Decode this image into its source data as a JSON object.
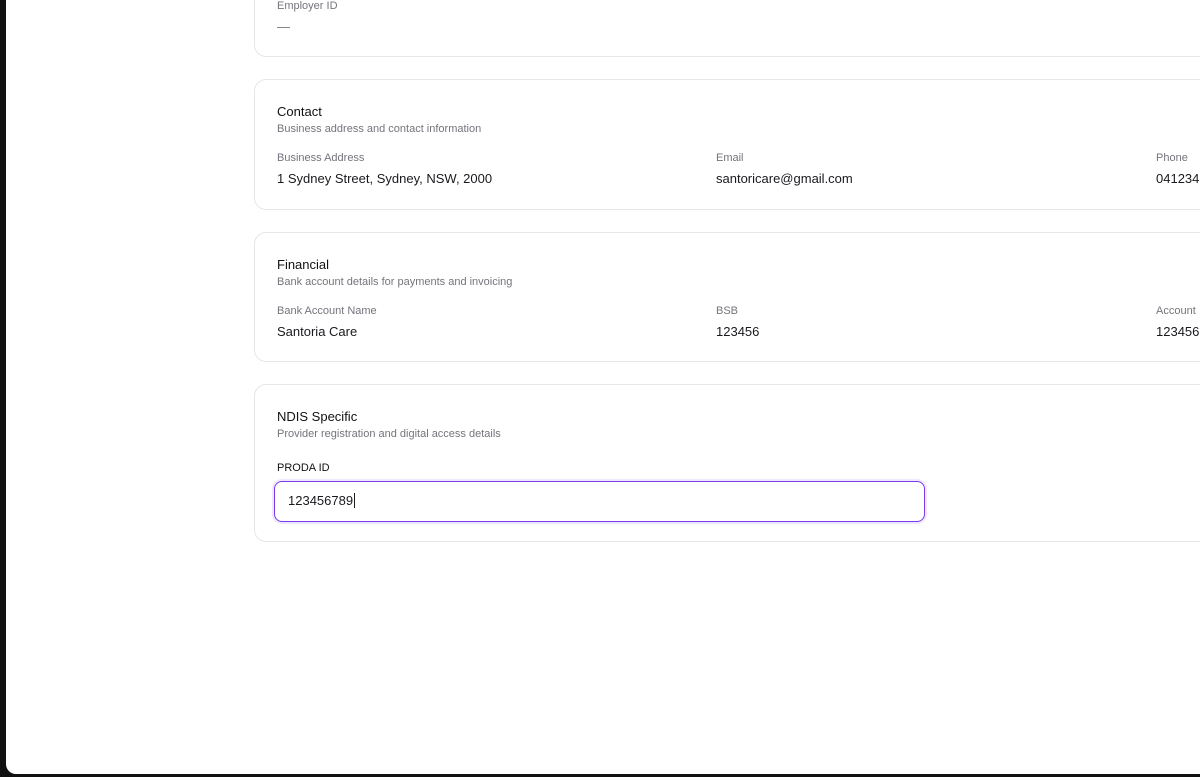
{
  "employer": {
    "label": "Employer ID",
    "value": "—"
  },
  "contact": {
    "title": "Contact",
    "subtitle": "Business address and contact information",
    "fields": [
      {
        "label": "Business Address",
        "value": "1 Sydney Street, Sydney, NSW, 2000"
      },
      {
        "label": "Email",
        "value": "santoricare@gmail.com"
      },
      {
        "label": "Phone",
        "value": "041234"
      }
    ]
  },
  "financial": {
    "title": "Financial",
    "subtitle": "Bank account details for payments and invoicing",
    "fields": [
      {
        "label": "Bank Account Name",
        "value": "Santoria Care"
      },
      {
        "label": "BSB",
        "value": "123456"
      },
      {
        "label": "Account",
        "value": "123456"
      }
    ]
  },
  "ndis": {
    "title": "NDIS Specific",
    "subtitle": "Provider registration and digital access details",
    "proda_label": "PRODA ID",
    "proda_value": "123456789"
  },
  "colors": {
    "focus_ring": "#7c3aed",
    "card_border": "#e6e6e9",
    "muted_text": "#74747c",
    "frame": "#111111"
  }
}
